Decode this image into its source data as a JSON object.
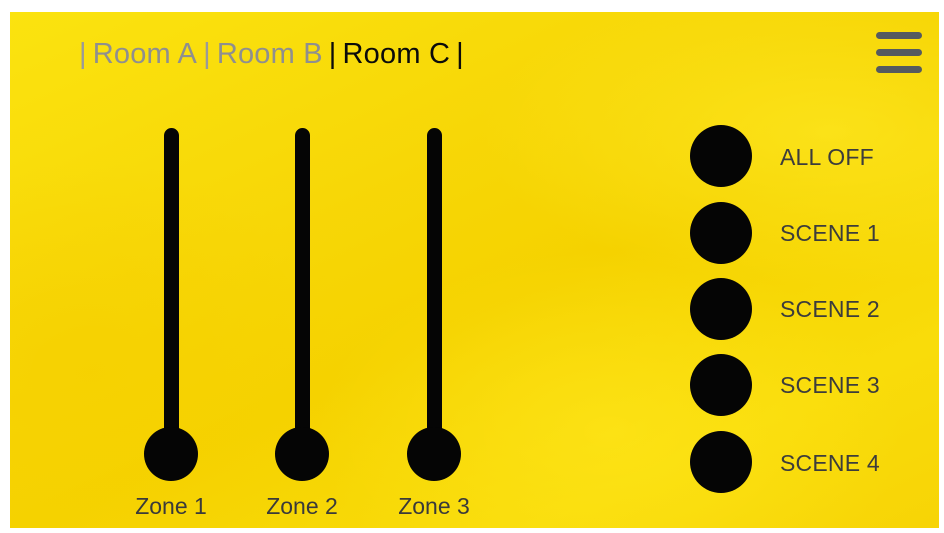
{
  "tabs": {
    "separator": "|",
    "items": [
      {
        "label": "Room A",
        "active": false
      },
      {
        "label": "Room B",
        "active": false
      },
      {
        "label": "Room C",
        "active": true
      }
    ]
  },
  "menu": {
    "icon": "hamburger-menu-icon"
  },
  "zones": [
    {
      "label": "Zone 1",
      "level": 0
    },
    {
      "label": "Zone 2",
      "level": 0
    },
    {
      "label": "Zone 3",
      "level": 0
    }
  ],
  "scenes": [
    {
      "label": "ALL OFF"
    },
    {
      "label": "SCENE 1"
    },
    {
      "label": "SCENE 2"
    },
    {
      "label": "SCENE 3"
    },
    {
      "label": "SCENE 4"
    }
  ],
  "colors": {
    "background": "#f7d707",
    "control": "#050505",
    "inactive_text": "#8f8f8f",
    "active_text": "#0b0b0b",
    "menu_icon": "#555a5f"
  }
}
